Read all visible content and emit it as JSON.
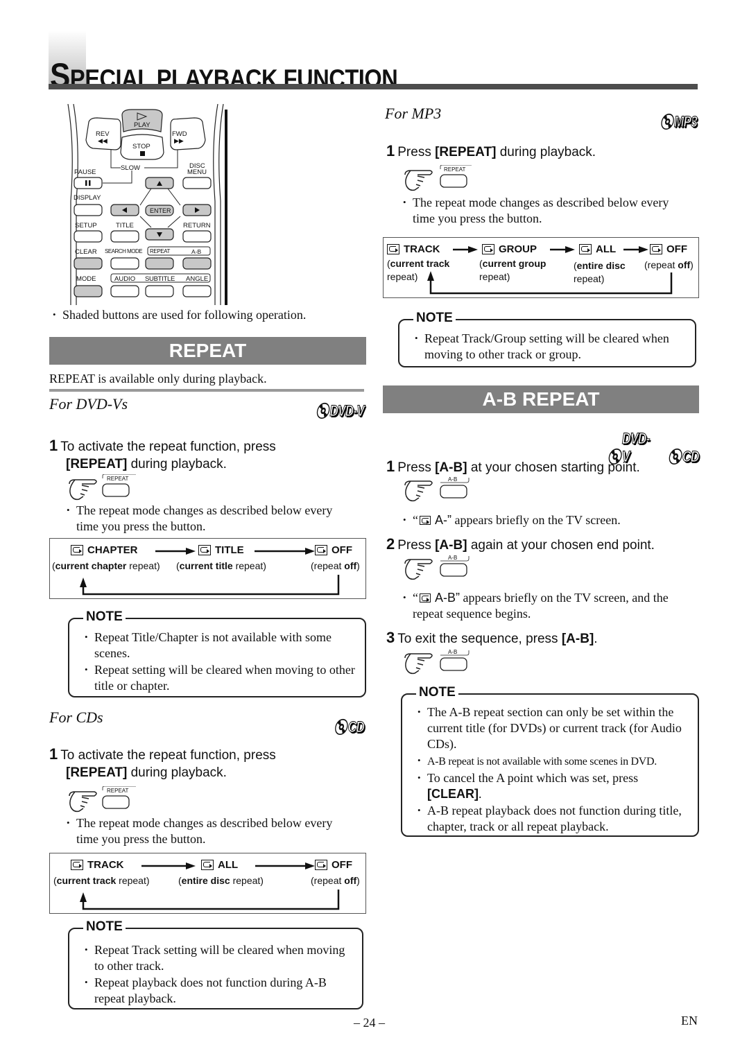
{
  "page": {
    "title_first_letter": "S",
    "title_rest": "PECIAL PLAYBACK FUNCTION",
    "page_number": "– 24 –",
    "language": "EN"
  },
  "remote": {
    "labels": {
      "play": "PLAY",
      "rev": "REV",
      "fwd": "FWD",
      "stop": "STOP",
      "slow": "SLOW",
      "pause": "PAUSE",
      "disc_menu_1": "DISC",
      "disc_menu_2": "MENU",
      "display": "DISPLAY",
      "enter": "ENTER",
      "setup": "SETUP",
      "title": "TITLE",
      "return": "RETURN",
      "clear": "CLEAR",
      "search_mode": "SEARCH MODE",
      "repeat": "REPEAT",
      "ab": "A-B",
      "mode": "MODE",
      "audio": "AUDIO",
      "subtitle": "SUBTITLE",
      "angle": "ANGLE"
    },
    "caption": "Shaded buttons are used for following operation.",
    "shaded_color": "#c8c8c8"
  },
  "repeat": {
    "header": "REPEAT",
    "intro": "REPEAT is available only during playback.",
    "dvd": {
      "heading": "For DVD-Vs",
      "logo": "DVD-V",
      "step_num": "1",
      "step_text_1": "To activate the repeat function, press",
      "step_bold": "[REPEAT]",
      "step_text_2": " during playback.",
      "button_label": "REPEAT",
      "bullet": "The repeat mode changes as described below every time you press the button.",
      "flow": [
        {
          "label": "CHAPTER",
          "desc_bold": "current chapter",
          "desc_rest": " repeat"
        },
        {
          "label": "TITLE",
          "desc_bold": "current title",
          "desc_rest": " repeat"
        },
        {
          "label": "OFF",
          "desc_pre": "repeat ",
          "desc_bold": "off"
        }
      ],
      "note_label": "NOTE",
      "notes": [
        "Repeat Title/Chapter is not available with some scenes.",
        "Repeat setting will be cleared when moving to other title or chapter."
      ]
    },
    "cd": {
      "heading": "For CDs",
      "logo": "CD",
      "step_num": "1",
      "step_text_1": "To activate the repeat function, press",
      "step_bold": "[REPEAT]",
      "step_text_2": " during playback.",
      "button_label": "REPEAT",
      "bullet": "The repeat mode changes as described below every time you press the button.",
      "flow": [
        {
          "label": "TRACK",
          "desc_bold": "current track",
          "desc_rest": " repeat"
        },
        {
          "label": "ALL",
          "desc_bold": "entire disc",
          "desc_rest": " repeat"
        },
        {
          "label": "OFF",
          "desc_pre": "repeat ",
          "desc_bold": "off"
        }
      ],
      "note_label": "NOTE",
      "notes": [
        "Repeat Track setting will be cleared when moving to other track.",
        "Repeat playback does not function during A-B repeat playback."
      ]
    },
    "mp3": {
      "heading": "For MP3",
      "logo": "MP3",
      "step_num": "1",
      "step_text_1": "Press ",
      "step_bold": "[REPEAT]",
      "step_text_2": " during playback.",
      "button_label": "REPEAT",
      "bullet": "The repeat mode changes as described below every time you press the button.",
      "flow": [
        {
          "label": "TRACK",
          "desc_bold": "current track",
          "desc_rest": "repeat"
        },
        {
          "label": "GROUP",
          "desc_bold": "current group",
          "desc_rest": "repeat"
        },
        {
          "label": "ALL",
          "desc_bold": "entire disc",
          "desc_rest": "repeat"
        },
        {
          "label": "OFF",
          "desc_pre": "repeat ",
          "desc_bold": "off"
        }
      ],
      "note_label": "NOTE",
      "notes": [
        "Repeat Track/Group setting will be cleared when moving to other track or group."
      ]
    }
  },
  "ab_repeat": {
    "header": "A-B REPEAT",
    "logos": [
      "DVD-V",
      "CD"
    ],
    "button_label": "A-B",
    "steps": [
      {
        "num": "1",
        "pre": "Press ",
        "bold": "[A-B]",
        "post": " at your chosen starting point.",
        "bullet_pre": "“",
        "bullet_code": " A-”",
        "bullet_post": " appears briefly on the TV screen."
      },
      {
        "num": "2",
        "pre": "Press ",
        "bold": "[A-B]",
        "post": " again at your chosen end point.",
        "bullet_pre": "“",
        "bullet_code": " A-B”",
        "bullet_post": " appears briefly on the TV screen, and the repeat sequence begins."
      },
      {
        "num": "3",
        "pre": "To exit the sequence, press ",
        "bold": "[A-B]",
        "post": "."
      }
    ],
    "note_label": "NOTE",
    "notes": [
      "The A-B repeat section can only be set within the current title (for DVDs) or current track (for Audio CDs).",
      "A-B repeat is not available with some scenes in DVD.",
      "To cancel the A point which was set, press",
      "A-B repeat playback does not function during title, chapter, track or all repeat playback."
    ],
    "note_clear_bold": "[CLEAR]",
    "note_clear_end": "."
  }
}
